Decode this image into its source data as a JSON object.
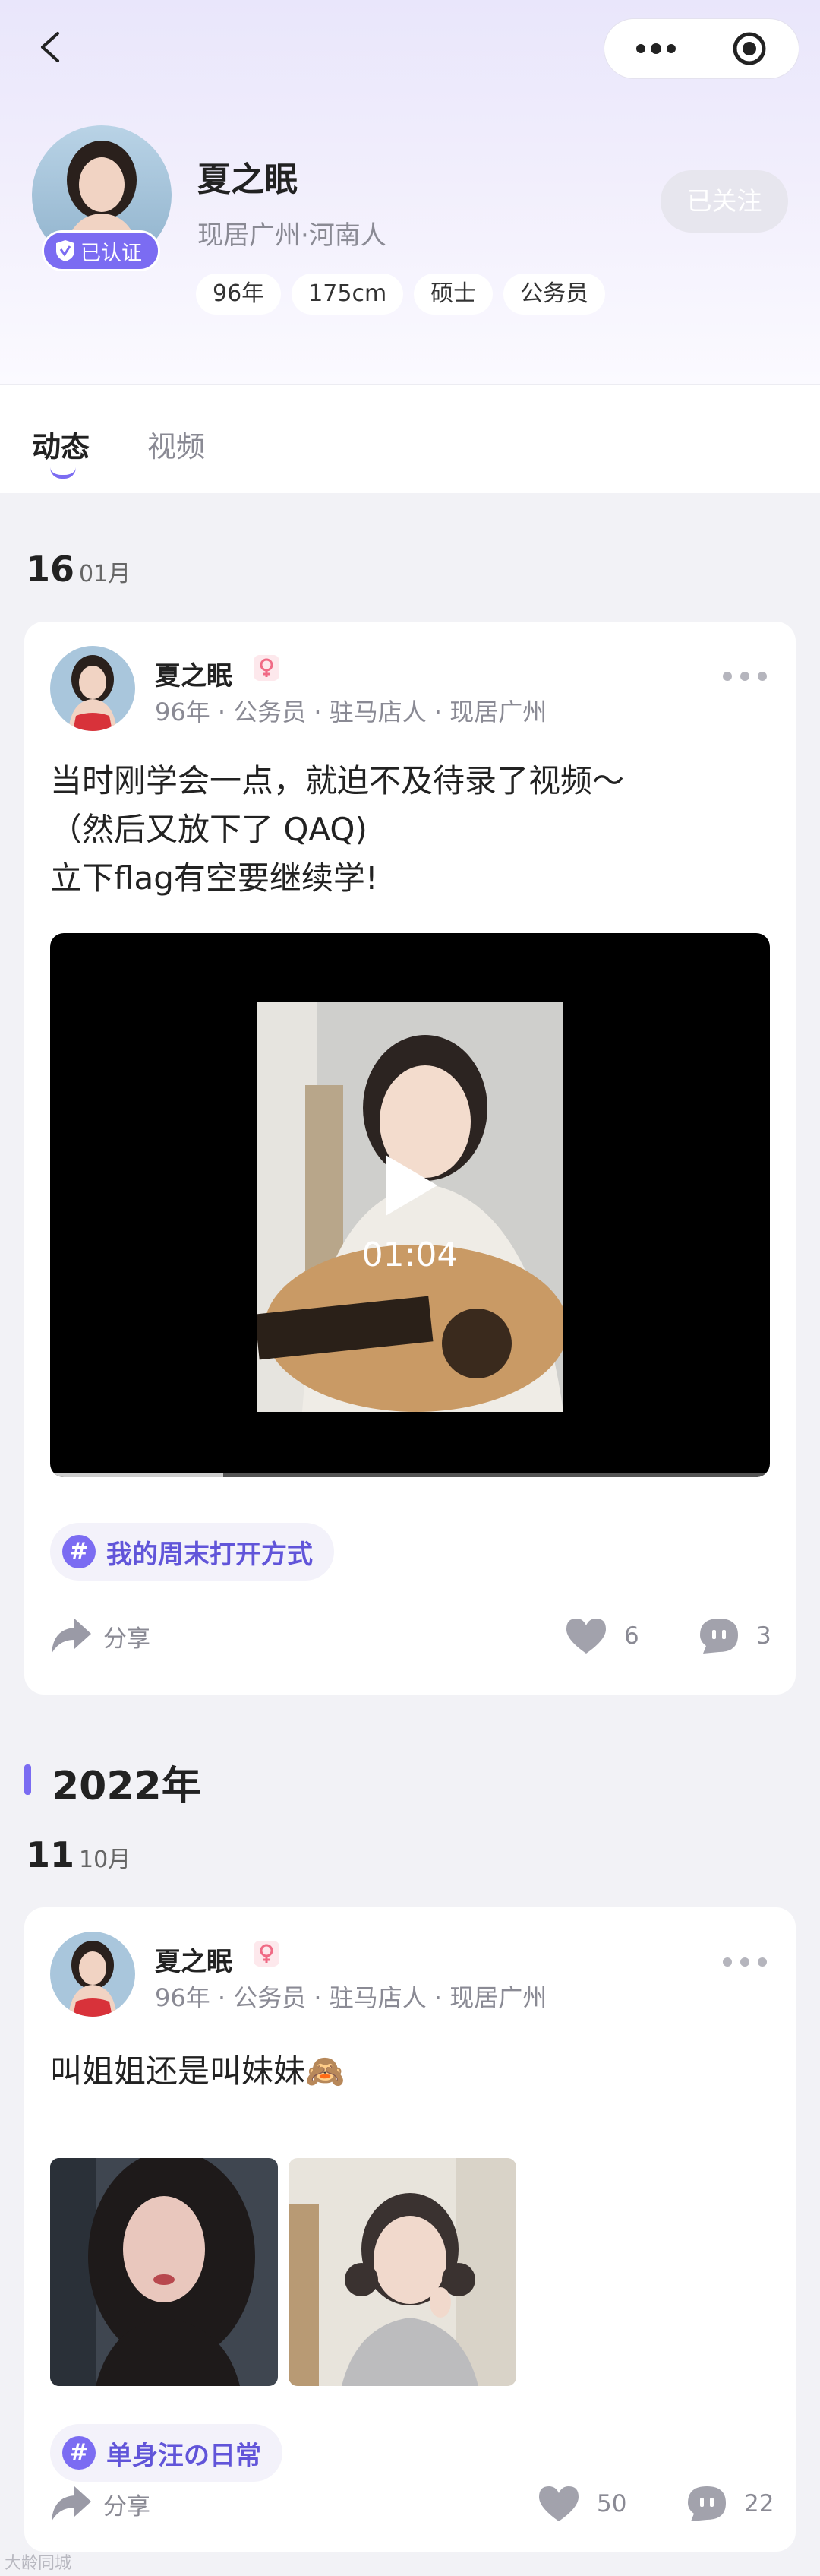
{
  "profile": {
    "name": "夏之眠",
    "location": "现居广州·河南人",
    "verified_label": "已认证",
    "tags": [
      "96年",
      "175cm",
      "硕士",
      "公务员"
    ],
    "follow_state": "已关注"
  },
  "tabs": [
    {
      "label": "动态",
      "active": true
    },
    {
      "label": "视频",
      "active": false
    }
  ],
  "feed": {
    "year_divider": "2022年",
    "posts": [
      {
        "date_day": "16",
        "date_month": "01月",
        "author": "夏之眠",
        "meta": "96年 · 公务员 · 驻马店人 · 现居广州",
        "text": "当时刚学会一点，就迫不及待录了视频～\n（然后又放下了 QAQ)\n立下flag有空要继续学!",
        "video_duration": "01:04",
        "video_progress": 0.24,
        "topic": "我的周末打开方式",
        "share_label": "分享",
        "likes": "6",
        "comments": "3"
      },
      {
        "date_day": "11",
        "date_month": "10月",
        "author": "夏之眠",
        "meta": "96年 · 公务员 · 驻马店人 · 现居广州",
        "text": "叫姐姐还是叫妹妹🙈",
        "topic": "单身汪の日常",
        "share_label": "分享",
        "likes": "50",
        "comments": "22"
      }
    ]
  },
  "watermark": "大龄同城",
  "colors": {
    "accent": "#7b6cf2",
    "topic_text": "#6155d9"
  }
}
